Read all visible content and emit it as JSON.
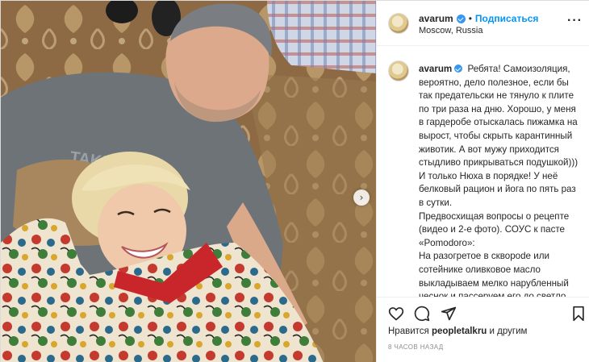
{
  "post": {
    "user": {
      "username": "avarum",
      "verified": true,
      "follow_label": "Подписаться",
      "separator": "•",
      "location": "Moscow, Russia",
      "more_icon": "more-horizontal-icon"
    },
    "caption": {
      "username": "avarum",
      "paragraphs": [
        "Ребята! Самоизоляция, вероятно, дело полезное, если бы так предательски не тянуло к плите по три раза на дню. Хорошо, у меня в гардеробе отыскалась пижамка на вырост, чтобы скрыть карантинный животик. А вот мужу приходится стыдливо прикрываться подушкой))) И только Нюха в порядке! У неё белковый рацион и йога по пять раз в сутки.",
        "Предвосхищая вопросы о рецепте (видео и 2-е фото). СОУС к пасте «Pomodoro»:",
        "На разогретое в скворode или сотейнике оливковое масло выкладываем мелко нарубленный чеснок и пассеруем его до светло золотистого цвета. После кладём в сотейник нарезанные кубиками"
      ]
    },
    "actions": {
      "like": "heart-icon",
      "comment": "comment-icon",
      "share": "paper-plane-icon",
      "save": "bookmark-icon"
    },
    "likes": {
      "prefix": "Нравится",
      "user": "peopletalkru",
      "suffix": "и другим"
    },
    "timestamp": "8 часов назад",
    "carousel_next_icon": "chevron-right-icon",
    "colors": {
      "accent": "#0095f6",
      "verified": "#3897f0",
      "text": "#262626",
      "muted": "#8e8e8e"
    }
  }
}
